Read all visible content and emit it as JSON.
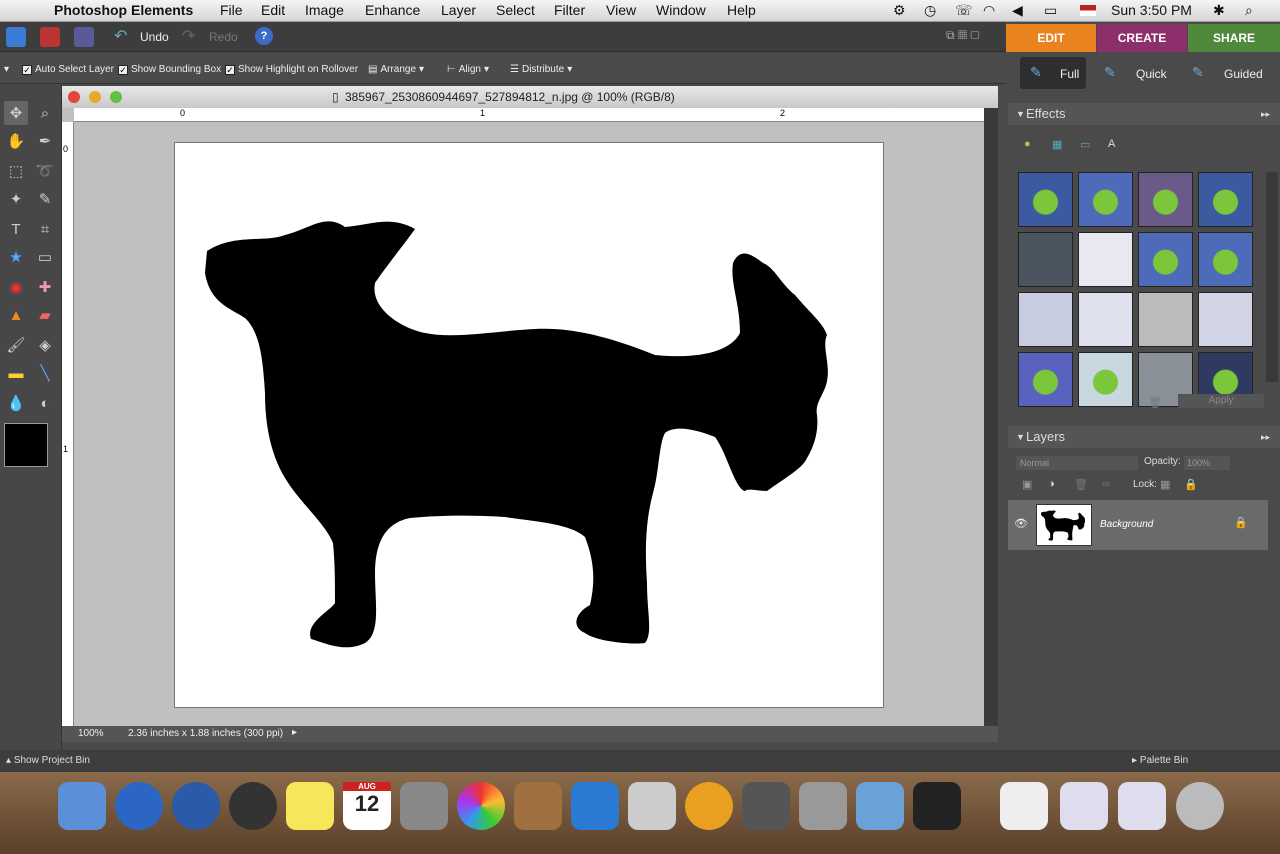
{
  "menubar": {
    "app": "Photoshop Elements",
    "menus": [
      "File",
      "Edit",
      "Image",
      "Enhance",
      "Layer",
      "Select",
      "Filter",
      "View",
      "Window",
      "Help"
    ],
    "clock": "Sun 3:50 PM"
  },
  "toolbar": {
    "undo": "Undo",
    "redo": "Redo",
    "help": "?"
  },
  "modes": {
    "edit": "EDIT",
    "create": "CREATE",
    "share": "SHARE"
  },
  "options": {
    "auto_select": "Auto Select Layer",
    "bounding_box": "Show Bounding Box",
    "highlight": "Show Highlight on Rollover",
    "arrange": "Arrange",
    "align": "Align",
    "distribute": "Distribute"
  },
  "document": {
    "title": "385967_2530860944697_527894812_n.jpg @ 100% (RGB/8)",
    "zoom": "100%",
    "info": "2.36 inches x 1.88 inches (300 ppi)",
    "ruler_h": [
      "0",
      "1",
      "2"
    ],
    "ruler_v": [
      "0",
      "1"
    ]
  },
  "views": {
    "full": "Full",
    "quick": "Quick",
    "guided": "Guided"
  },
  "effects": {
    "title": "Effects",
    "apply": "Apply"
  },
  "layers": {
    "title": "Layers",
    "blend": "Normal",
    "opacity_label": "Opacity:",
    "opacity": "100%",
    "lock": "Lock:",
    "layer_name": "Background"
  },
  "bottom": {
    "project_bin": "Show Project Bin",
    "palette_bin": "Palette Bin"
  },
  "dock_calendar": {
    "month": "AUG",
    "day": "12"
  }
}
